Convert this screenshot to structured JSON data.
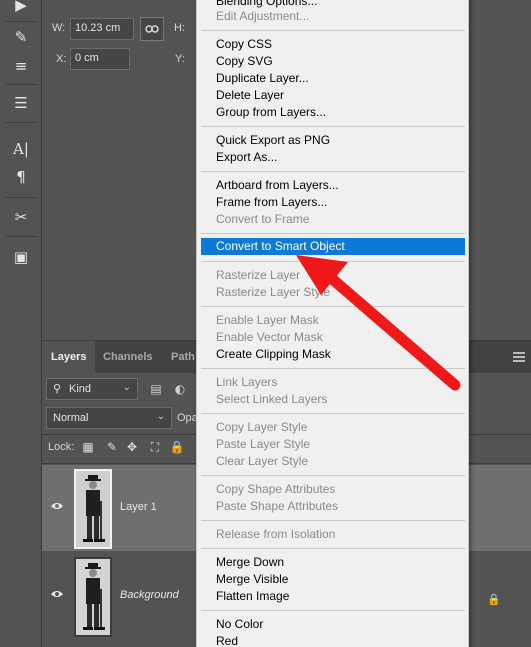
{
  "properties": {
    "w_label": "W:",
    "w_value": "10.23 cm",
    "h_label": "H:",
    "x_label": "X:",
    "x_value": "0 cm",
    "y_label": "Y:"
  },
  "layers_panel": {
    "tabs": [
      "Layers",
      "Channels",
      "Path"
    ],
    "filter_kind": "Kind",
    "blend_mode": "Normal",
    "opacity_label": "Opa",
    "lock_label": "Lock:",
    "layers": [
      {
        "name": "Layer 1",
        "selected": true
      },
      {
        "name": "Background",
        "selected": false,
        "locked": true
      }
    ]
  },
  "context_menu": {
    "items": [
      {
        "label": "Blending Options...",
        "disabled": false
      },
      {
        "label": "Edit Adjustment...",
        "disabled": true
      },
      {
        "label": "Copy CSS",
        "disabled": false
      },
      {
        "label": "Copy SVG",
        "disabled": false
      },
      {
        "label": "Duplicate Layer...",
        "disabled": false
      },
      {
        "label": "Delete Layer",
        "disabled": false
      },
      {
        "label": "Group from Layers...",
        "disabled": false
      },
      {
        "label": "Quick Export as PNG",
        "disabled": false
      },
      {
        "label": "Export As...",
        "disabled": false
      },
      {
        "label": "Artboard from Layers...",
        "disabled": false
      },
      {
        "label": "Frame from Layers...",
        "disabled": false
      },
      {
        "label": "Convert to Frame",
        "disabled": true
      },
      {
        "label": "Convert to Smart Object",
        "disabled": false,
        "highlighted": true
      },
      {
        "label": "Rasterize Layer",
        "disabled": true
      },
      {
        "label": "Rasterize Layer Style",
        "disabled": true
      },
      {
        "label": "Enable Layer Mask",
        "disabled": true
      },
      {
        "label": "Enable Vector Mask",
        "disabled": true
      },
      {
        "label": "Create Clipping Mask",
        "disabled": false
      },
      {
        "label": "Link Layers",
        "disabled": true
      },
      {
        "label": "Select Linked Layers",
        "disabled": true
      },
      {
        "label": "Copy Layer Style",
        "disabled": true
      },
      {
        "label": "Paste Layer Style",
        "disabled": true
      },
      {
        "label": "Clear Layer Style",
        "disabled": true
      },
      {
        "label": "Copy Shape Attributes",
        "disabled": true
      },
      {
        "label": "Paste Shape Attributes",
        "disabled": true
      },
      {
        "label": "Release from Isolation",
        "disabled": true
      },
      {
        "label": "Merge Down",
        "disabled": false
      },
      {
        "label": "Merge Visible",
        "disabled": false
      },
      {
        "label": "Flatten Image",
        "disabled": false
      },
      {
        "label": "No Color",
        "disabled": false
      },
      {
        "label": "Red",
        "disabled": false
      }
    ]
  },
  "colors": {
    "highlight": "#0c79d6",
    "annotation_arrow": "#f01818"
  },
  "icons": [
    "play-icon",
    "brush-settings-icon",
    "adjust-icon",
    "stamp-list-icon",
    "text-cursor-icon",
    "paragraph-icon",
    "scissors-icon",
    "book-icon",
    "link-icon",
    "eye-icon",
    "lock-icon"
  ]
}
